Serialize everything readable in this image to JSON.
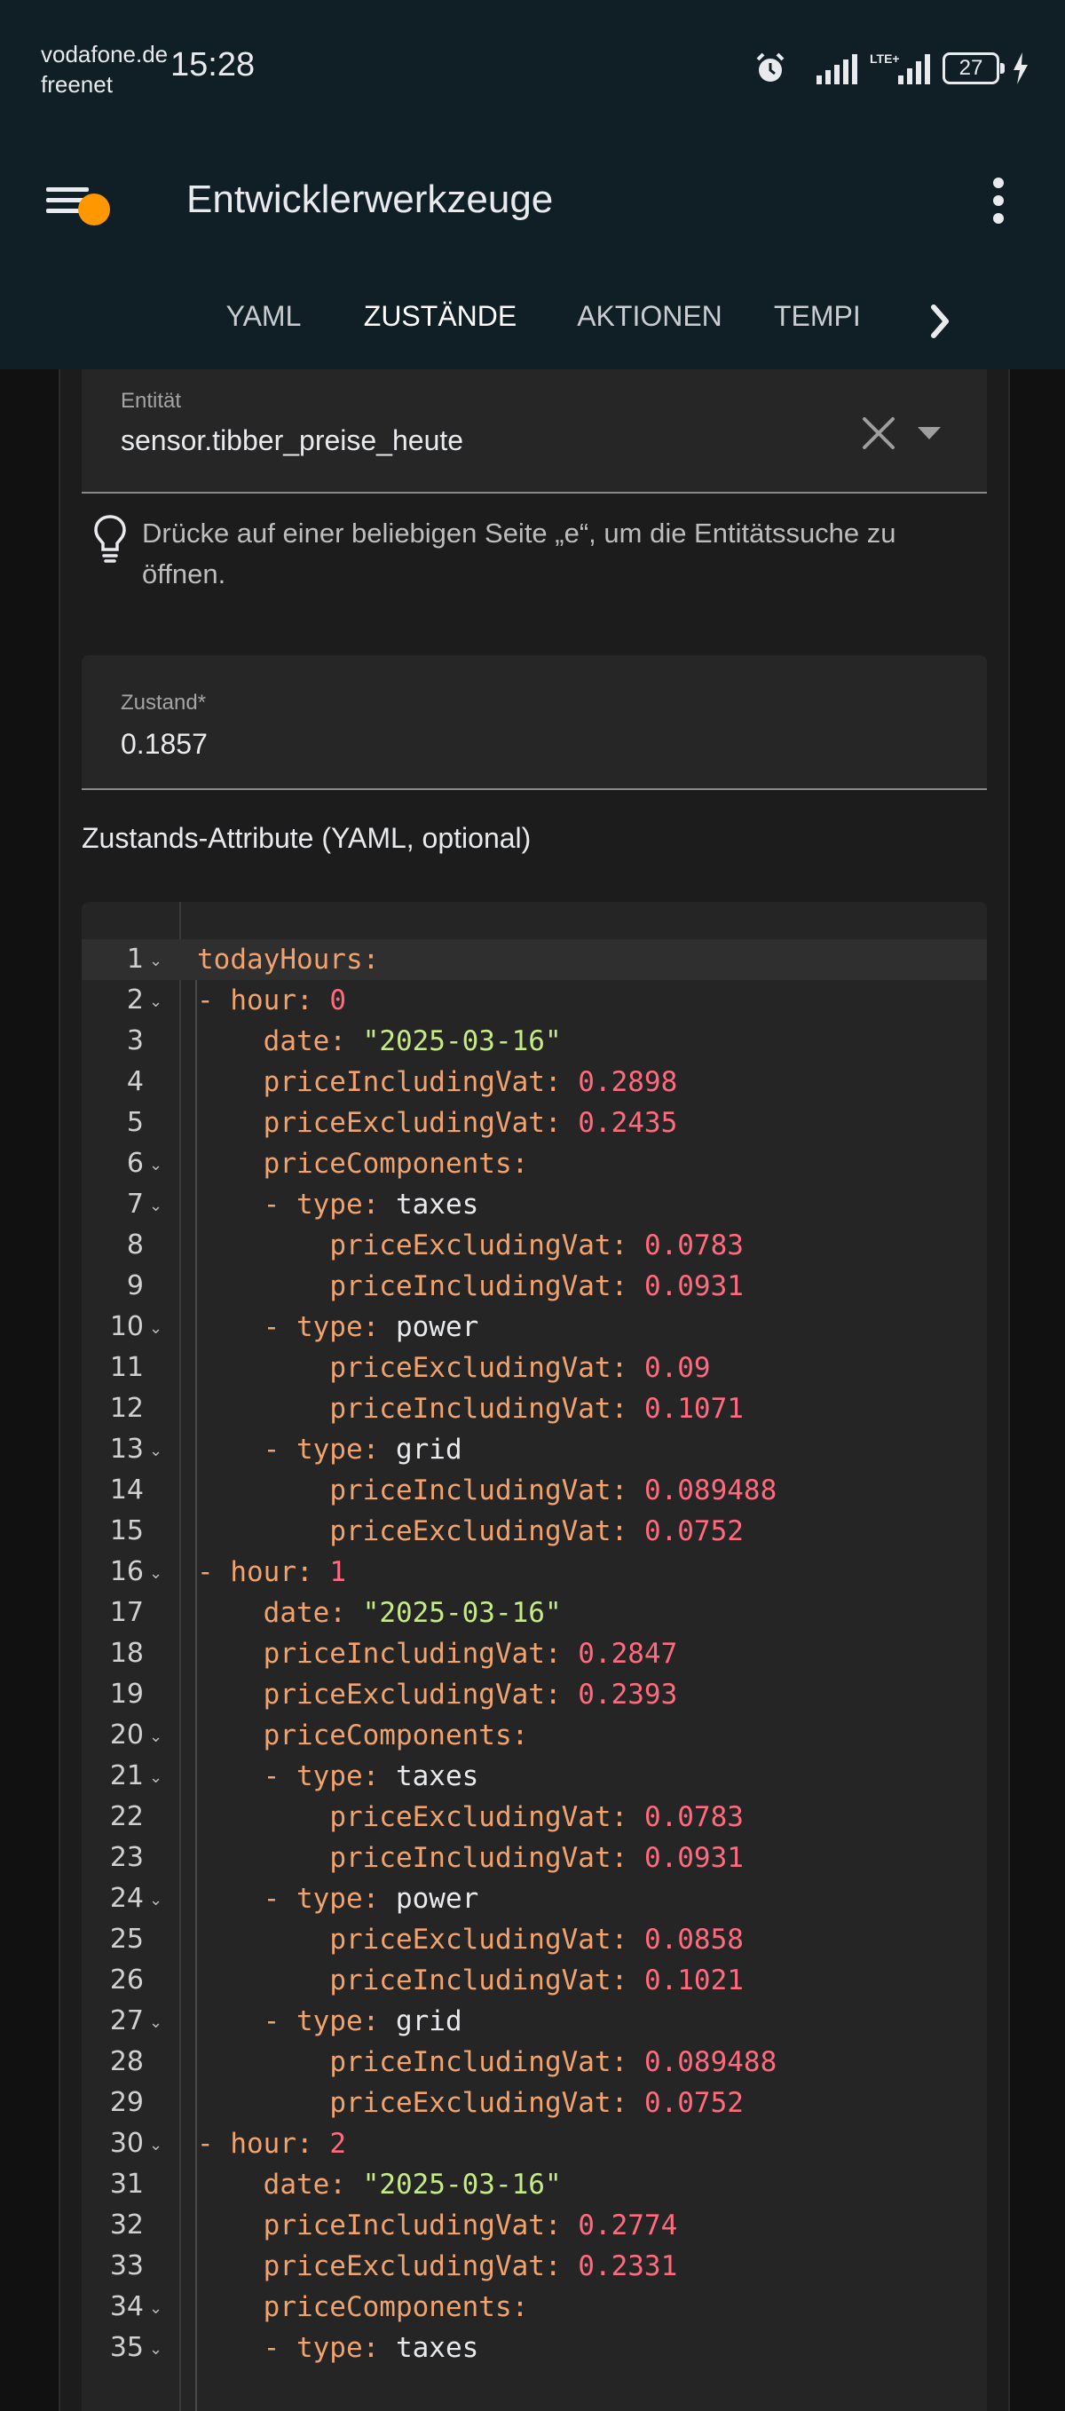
{
  "status_bar": {
    "carrier_line1": "vodafone.de",
    "carrier_line2": "freenet",
    "time": "15:28",
    "network_type": "LTE+",
    "battery": "27",
    "icons": [
      "alarm-icon",
      "signal-icon",
      "lte-signal-icon",
      "battery-icon",
      "charging-icon"
    ]
  },
  "app_bar": {
    "title": "Entwicklerwerkzeuge",
    "badge_color": "#ff9800"
  },
  "tabs": [
    {
      "label": "YAML",
      "active": false
    },
    {
      "label": "ZUSTÄNDE",
      "active": true
    },
    {
      "label": "AKTIONEN",
      "active": false
    },
    {
      "label": "TEMPI",
      "active": false
    }
  ],
  "entity_field": {
    "label": "Entität",
    "value": "sensor.tibber_preise_heute"
  },
  "hint": "Drücke auf einer beliebigen Seite „e“, um die Entitätssuche zu öffnen.",
  "state_field": {
    "label": "Zustand*",
    "value": "0.1857"
  },
  "attributes_heading": "Zustands-Attribute (YAML, optional)",
  "yaml_lines": [
    {
      "n": "1",
      "fold": true,
      "indent": 0,
      "key": "todayHours",
      "dash": false,
      "val": null,
      "vt": null
    },
    {
      "n": "2",
      "fold": true,
      "indent": 1,
      "key": "hour",
      "dash": true,
      "val": "0",
      "vt": "n"
    },
    {
      "n": "3",
      "fold": false,
      "indent": 2,
      "key": "date",
      "dash": false,
      "val": "\"2025-03-16\"",
      "vt": "s"
    },
    {
      "n": "4",
      "fold": false,
      "indent": 2,
      "key": "priceIncludingVat",
      "dash": false,
      "val": "0.2898",
      "vt": "n"
    },
    {
      "n": "5",
      "fold": false,
      "indent": 2,
      "key": "priceExcludingVat",
      "dash": false,
      "val": "0.2435",
      "vt": "n"
    },
    {
      "n": "6",
      "fold": true,
      "indent": 2,
      "key": "priceComponents",
      "dash": false,
      "val": null,
      "vt": null
    },
    {
      "n": "7",
      "fold": true,
      "indent": 3,
      "key": "type",
      "dash": true,
      "val": "taxes",
      "vt": "p"
    },
    {
      "n": "8",
      "fold": false,
      "indent": 4,
      "key": "priceExcludingVat",
      "dash": false,
      "val": "0.0783",
      "vt": "n"
    },
    {
      "n": "9",
      "fold": false,
      "indent": 4,
      "key": "priceIncludingVat",
      "dash": false,
      "val": "0.0931",
      "vt": "n"
    },
    {
      "n": "10",
      "fold": true,
      "indent": 3,
      "key": "type",
      "dash": true,
      "val": "power",
      "vt": "p"
    },
    {
      "n": "11",
      "fold": false,
      "indent": 4,
      "key": "priceExcludingVat",
      "dash": false,
      "val": "0.09",
      "vt": "n"
    },
    {
      "n": "12",
      "fold": false,
      "indent": 4,
      "key": "priceIncludingVat",
      "dash": false,
      "val": "0.1071",
      "vt": "n"
    },
    {
      "n": "13",
      "fold": true,
      "indent": 3,
      "key": "type",
      "dash": true,
      "val": "grid",
      "vt": "p"
    },
    {
      "n": "14",
      "fold": false,
      "indent": 4,
      "key": "priceIncludingVat",
      "dash": false,
      "val": "0.089488",
      "vt": "n"
    },
    {
      "n": "15",
      "fold": false,
      "indent": 4,
      "key": "priceExcludingVat",
      "dash": false,
      "val": "0.0752",
      "vt": "n"
    },
    {
      "n": "16",
      "fold": true,
      "indent": 1,
      "key": "hour",
      "dash": true,
      "val": "1",
      "vt": "n"
    },
    {
      "n": "17",
      "fold": false,
      "indent": 2,
      "key": "date",
      "dash": false,
      "val": "\"2025-03-16\"",
      "vt": "s"
    },
    {
      "n": "18",
      "fold": false,
      "indent": 2,
      "key": "priceIncludingVat",
      "dash": false,
      "val": "0.2847",
      "vt": "n"
    },
    {
      "n": "19",
      "fold": false,
      "indent": 2,
      "key": "priceExcludingVat",
      "dash": false,
      "val": "0.2393",
      "vt": "n"
    },
    {
      "n": "20",
      "fold": true,
      "indent": 2,
      "key": "priceComponents",
      "dash": false,
      "val": null,
      "vt": null
    },
    {
      "n": "21",
      "fold": true,
      "indent": 3,
      "key": "type",
      "dash": true,
      "val": "taxes",
      "vt": "p"
    },
    {
      "n": "22",
      "fold": false,
      "indent": 4,
      "key": "priceExcludingVat",
      "dash": false,
      "val": "0.0783",
      "vt": "n"
    },
    {
      "n": "23",
      "fold": false,
      "indent": 4,
      "key": "priceIncludingVat",
      "dash": false,
      "val": "0.0931",
      "vt": "n"
    },
    {
      "n": "24",
      "fold": true,
      "indent": 3,
      "key": "type",
      "dash": true,
      "val": "power",
      "vt": "p"
    },
    {
      "n": "25",
      "fold": false,
      "indent": 4,
      "key": "priceExcludingVat",
      "dash": false,
      "val": "0.0858",
      "vt": "n"
    },
    {
      "n": "26",
      "fold": false,
      "indent": 4,
      "key": "priceIncludingVat",
      "dash": false,
      "val": "0.1021",
      "vt": "n"
    },
    {
      "n": "27",
      "fold": true,
      "indent": 3,
      "key": "type",
      "dash": true,
      "val": "grid",
      "vt": "p"
    },
    {
      "n": "28",
      "fold": false,
      "indent": 4,
      "key": "priceIncludingVat",
      "dash": false,
      "val": "0.089488",
      "vt": "n"
    },
    {
      "n": "29",
      "fold": false,
      "indent": 4,
      "key": "priceExcludingVat",
      "dash": false,
      "val": "0.0752",
      "vt": "n"
    },
    {
      "n": "30",
      "fold": true,
      "indent": 1,
      "key": "hour",
      "dash": true,
      "val": "2",
      "vt": "n"
    },
    {
      "n": "31",
      "fold": false,
      "indent": 2,
      "key": "date",
      "dash": false,
      "val": "\"2025-03-16\"",
      "vt": "s"
    },
    {
      "n": "32",
      "fold": false,
      "indent": 2,
      "key": "priceIncludingVat",
      "dash": false,
      "val": "0.2774",
      "vt": "n"
    },
    {
      "n": "33",
      "fold": false,
      "indent": 2,
      "key": "priceExcludingVat",
      "dash": false,
      "val": "0.2331",
      "vt": "n"
    },
    {
      "n": "34",
      "fold": true,
      "indent": 2,
      "key": "priceComponents",
      "dash": false,
      "val": null,
      "vt": null
    },
    {
      "n": "35",
      "fold": true,
      "indent": 3,
      "key": "type",
      "dash": true,
      "val": "taxes",
      "vt": "p"
    }
  ],
  "colors": {
    "app_bar_bg": "#101e25",
    "yaml_key": "#f0a36f",
    "yaml_number": "#ff6b7e",
    "yaml_string": "#c6ea86"
  }
}
